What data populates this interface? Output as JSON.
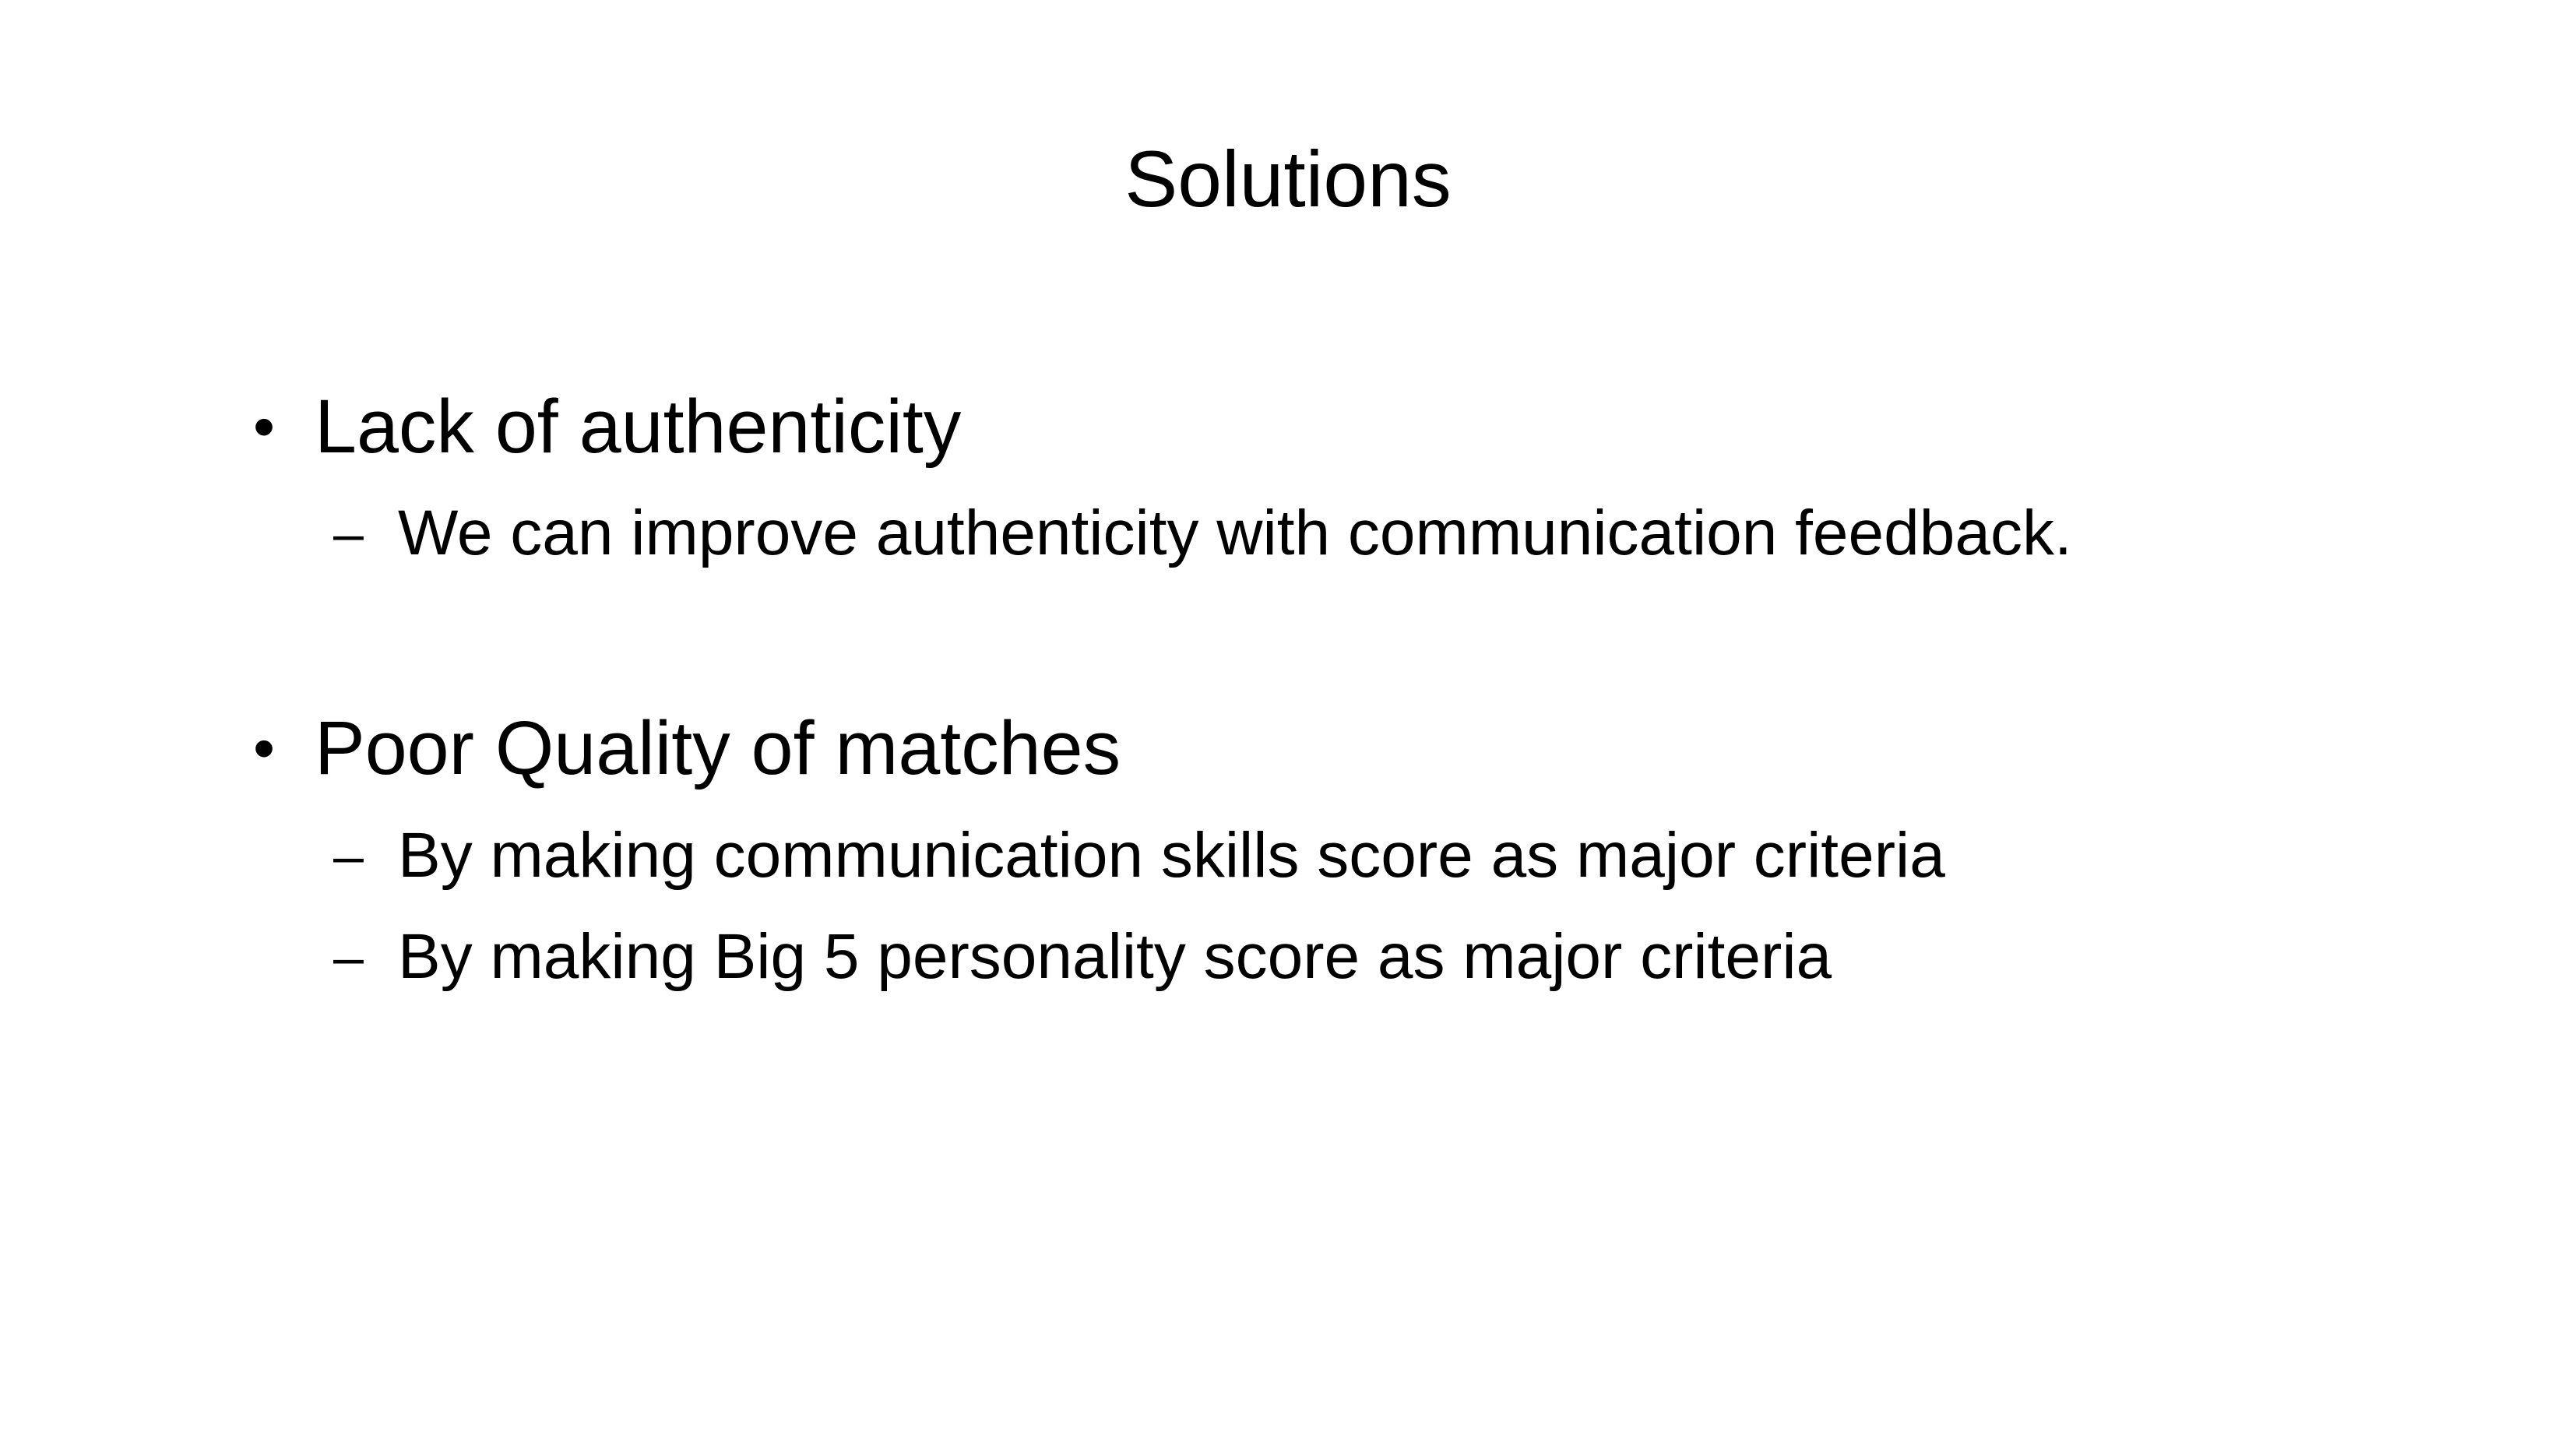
{
  "slide": {
    "title": "Solutions",
    "sections": [
      {
        "bullet": "•",
        "heading": "Lack of authenticity",
        "items": [
          {
            "marker": "–",
            "text": "We can improve authenticity with communication feedback."
          }
        ]
      },
      {
        "bullet": "•",
        "heading": "Poor Quality of matches",
        "items": [
          {
            "marker": "–",
            "text": "By making communication skills score as major criteria"
          },
          {
            "marker": "–",
            "text": "By making Big 5 personality score as major criteria"
          }
        ]
      }
    ]
  }
}
